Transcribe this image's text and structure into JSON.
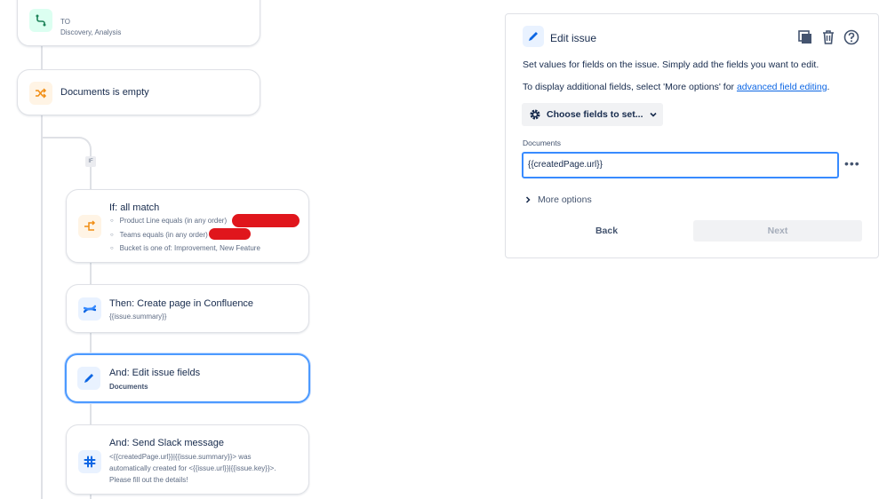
{
  "flow": {
    "trigger_card": {
      "line1": "TO",
      "line2": "Discovery, Analysis"
    },
    "condition_card": {
      "title": "Documents is empty"
    },
    "if_badge": "IF",
    "if_card": {
      "title": "If: all match",
      "bullets": [
        "Product Line equals (in any order)",
        "Teams equals (in any order)",
        "Bucket is one of: Improvement, New Feature"
      ]
    },
    "confluence_card": {
      "title": "Then: Create page in Confluence",
      "subtitle": "{{issue.summary}}"
    },
    "edit_card": {
      "title": "And: Edit issue fields",
      "subtitle": "Documents"
    },
    "slack_card": {
      "title": "And: Send Slack message",
      "lines": [
        "<{{createdPage.url}}|{{issue.summary}}> was",
        "automatically created for <{{issue.url}}|{{issue.key}}>.",
        "Please fill out the details!"
      ]
    }
  },
  "panel": {
    "title": "Edit issue",
    "description": "Set values for fields on the issue. Simply add the fields you want to edit.",
    "additional_prefix": "To display additional fields, select 'More options' for ",
    "additional_link": "advanced field editing",
    "additional_suffix": ".",
    "choose_fields_label": "Choose fields to set...",
    "field_label": "Documents",
    "field_value": "{{createdPage.url}}",
    "more_options_label": "More options",
    "back_label": "Back",
    "next_label": "Next"
  },
  "colors": {
    "accent_blue": "#0c66e4",
    "selected_border": "#4c9aff",
    "condition_orange": "#f18d13",
    "trigger_green": "#1f845a",
    "redaction_red": "#e0161c"
  }
}
